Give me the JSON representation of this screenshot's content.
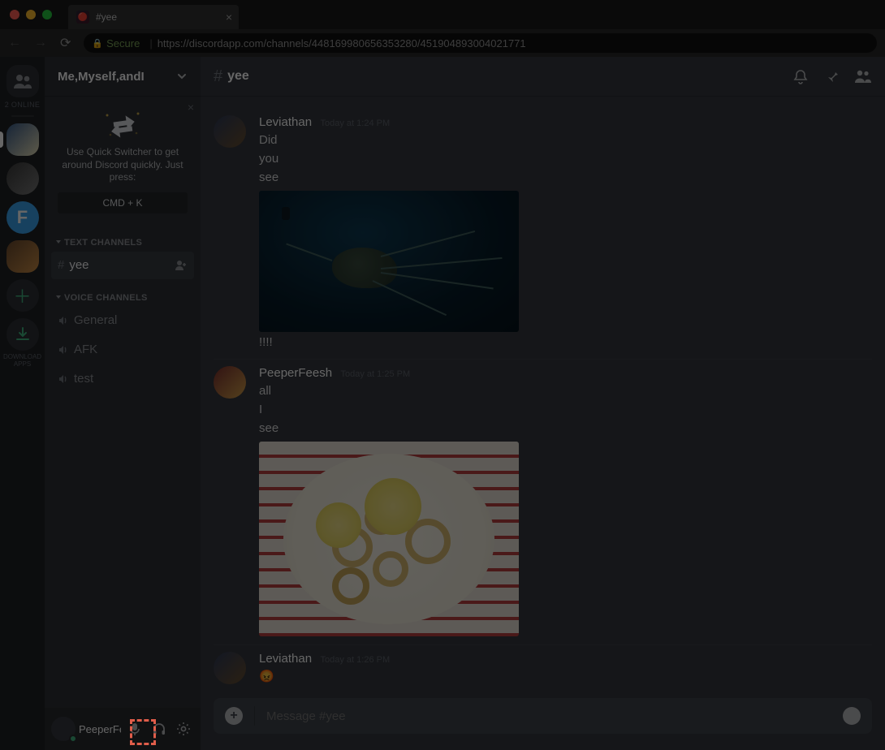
{
  "browser": {
    "tab_title": "#yee",
    "secure_label": "Secure",
    "url": "https://discordapp.com/channels/448169980656353280/451904893004021771"
  },
  "guilds": {
    "online_count": "2 ONLINE",
    "download_label": "DOWNLOAD APPS",
    "f_label": "F"
  },
  "sidebar": {
    "server_name": "Me,Myself,andI",
    "quick_switch": {
      "tip": "Use Quick Switcher to get around Discord quickly. Just press:",
      "kbd": "CMD + K"
    },
    "text_channels_label": "TEXT CHANNELS",
    "text_channels": [
      {
        "name": "yee"
      }
    ],
    "voice_channels_label": "VOICE CHANNELS",
    "voice_channels": [
      {
        "name": "General"
      },
      {
        "name": "AFK"
      },
      {
        "name": "test"
      }
    ],
    "user": {
      "name": "PeeperFeesh",
      "status_color": "#43b581"
    }
  },
  "chat": {
    "channel_name": "yee",
    "composer_placeholder": "Message #yee",
    "messages": [
      {
        "author": "Leviathan",
        "timestamp": "Today at 1:24 PM",
        "lines": [
          "Did",
          "you",
          "see"
        ],
        "after": [
          "!!!!"
        ],
        "image": "sea"
      },
      {
        "author": "PeeperFeesh",
        "timestamp": "Today at 1:25 PM",
        "lines": [
          "all",
          "I",
          "see"
        ],
        "after": [],
        "image": "food"
      },
      {
        "author": "Leviathan",
        "timestamp": "Today at 1:26 PM",
        "lines": [],
        "after": [],
        "emoji": "😡"
      }
    ]
  }
}
